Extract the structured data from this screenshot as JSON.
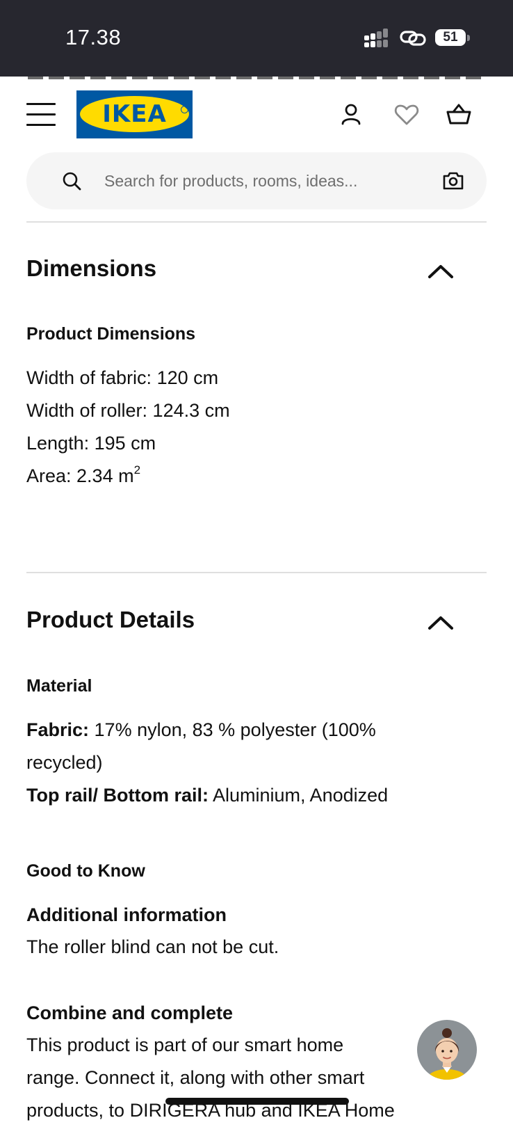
{
  "status_bar": {
    "time": "17.38",
    "battery": "51",
    "icons": [
      "signal-icon",
      "link-icon",
      "battery-icon"
    ]
  },
  "header": {
    "logo_text": "IKEA",
    "icons": [
      "menu-icon",
      "account-icon",
      "heart-icon",
      "basket-icon"
    ],
    "brand_colors": {
      "blue": "#0058a3",
      "yellow": "#ffdb00"
    }
  },
  "search": {
    "placeholder": "Search for products, rooms, ideas...",
    "value": ""
  },
  "dimensions": {
    "title": "Dimensions",
    "subtitle": "Product Dimensions",
    "lines": {
      "fabric_width": "Width of fabric: 120 cm",
      "roller_width": "Width of roller: 124.3 cm",
      "length": "Length: 195 cm",
      "area": "Area: 2.34 m",
      "area_sup": "2"
    }
  },
  "product_details": {
    "title": "Product Details",
    "material_heading": "Material",
    "fabric_label": "Fabric:",
    "fabric_value": " 17% nylon, 83 % polyester (100% recycled)",
    "rail_label": "Top rail/ Bottom rail:",
    "rail_value": " Aluminium, Anodized",
    "good_to_know": "Good to Know",
    "additional_heading": "Additional information",
    "additional_text": "The roller blind can not be cut.",
    "combine_heading": "Combine and complete",
    "combine_text": "This product is part of our smart home range. Connect it, along with other smart products, to DIRIGERA hub and IKEA Home"
  }
}
